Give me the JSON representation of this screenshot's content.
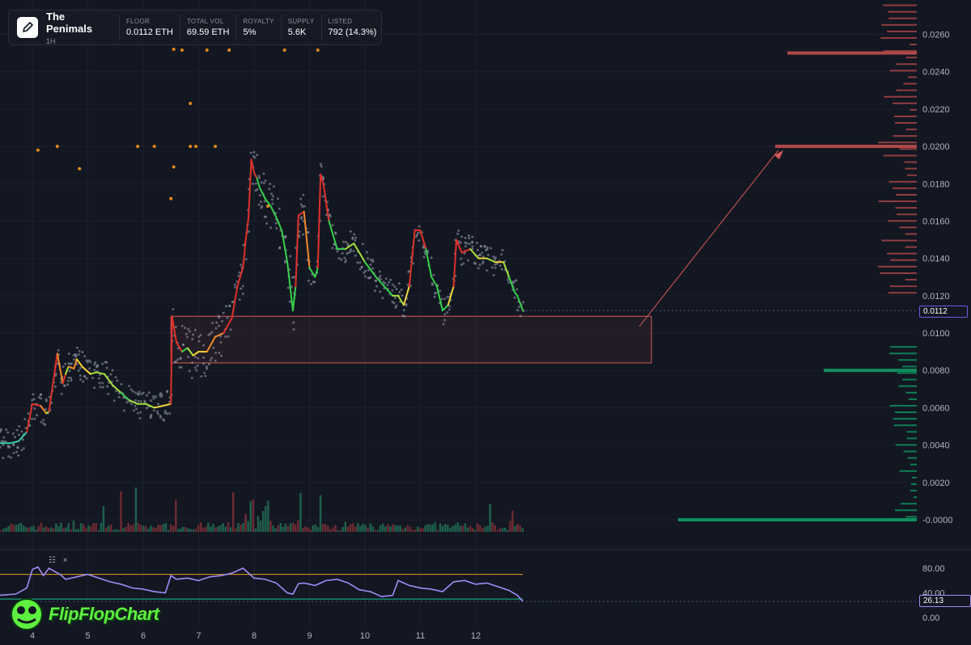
{
  "header": {
    "title": "The Penimals",
    "interval": "1H",
    "stats": [
      {
        "label": "FLOOR",
        "value": "0.0112 ETH"
      },
      {
        "label": "TOTAL VOL",
        "value": "69.59 ETH"
      },
      {
        "label": "ROYALTY",
        "value": "5%"
      },
      {
        "label": "SUPPLY",
        "value": "5.6K"
      },
      {
        "label": "LISTED",
        "value": "792 (14.3%)"
      }
    ]
  },
  "price_tag": "0.0112",
  "rsi_tag": "26.13",
  "watermark": "FlipFlopChart",
  "rsi_tools": {
    "settings": "☷",
    "close": "×"
  },
  "colors": {
    "background": "#131722",
    "ask_wall": "#b04848",
    "bid_wall": "#0f8f5e",
    "rsi_line": "#a08cf8",
    "rsi_upper": "#f0a020",
    "rsi_lower": "#19c39b",
    "zone": "#d65a5a"
  },
  "chart_data": [
    {
      "type": "line",
      "name": "floor price",
      "x_tick_labels": [
        "4",
        "5",
        "6",
        "7",
        "8",
        "9",
        "10",
        "11",
        "12"
      ],
      "y_tick_labels": [
        "0.0260",
        "0.0240",
        "0.0220",
        "0.0200",
        "0.0180",
        "0.0160",
        "0.0140",
        "0.0120",
        "0.0100",
        "0.0080",
        "0.0060",
        "0.0040",
        "0.0020",
        "-0.0000"
      ],
      "ylim": [
        0,
        0.0274
      ],
      "xlim": [
        3.4,
        12.95
      ],
      "x": [
        3.4,
        3.6,
        3.75,
        3.9,
        4.0,
        4.15,
        4.25,
        4.3,
        4.45,
        4.55,
        4.6,
        4.65,
        4.75,
        4.8,
        4.9,
        5.05,
        5.15,
        5.3,
        5.45,
        5.6,
        5.75,
        5.9,
        6.05,
        6.2,
        6.35,
        6.5,
        6.52,
        6.6,
        6.7,
        6.8,
        6.9,
        7.0,
        7.15,
        7.3,
        7.45,
        7.6,
        7.7,
        7.8,
        7.85,
        7.9,
        7.95,
        8.0,
        8.05,
        8.1,
        8.2,
        8.3,
        8.4,
        8.5,
        8.6,
        8.7,
        8.75,
        8.8,
        8.9,
        9.0,
        9.1,
        9.15,
        9.2,
        9.25,
        9.35,
        9.5,
        9.65,
        9.8,
        10.0,
        10.2,
        10.35,
        10.5,
        10.6,
        10.7,
        10.8,
        10.9,
        11.0,
        11.1,
        11.2,
        11.3,
        11.4,
        11.5,
        11.6,
        11.65,
        11.75,
        11.9,
        12.05,
        12.2,
        12.35,
        12.5,
        12.6,
        12.7,
        12.75,
        12.85
      ],
      "y": [
        0.0041,
        0.0041,
        0.0042,
        0.0047,
        0.0062,
        0.0061,
        0.0057,
        0.0058,
        0.0089,
        0.0073,
        0.0078,
        0.0082,
        0.0081,
        0.0086,
        0.0082,
        0.0078,
        0.0079,
        0.0078,
        0.0072,
        0.0068,
        0.0064,
        0.0062,
        0.0062,
        0.006,
        0.0061,
        0.0062,
        0.0109,
        0.0095,
        0.009,
        0.0092,
        0.0088,
        0.009,
        0.009,
        0.0098,
        0.01,
        0.0108,
        0.0125,
        0.0135,
        0.015,
        0.0162,
        0.0193,
        0.0186,
        0.0183,
        0.0178,
        0.0172,
        0.0168,
        0.0162,
        0.0155,
        0.0138,
        0.0112,
        0.0125,
        0.0163,
        0.0165,
        0.0135,
        0.013,
        0.0135,
        0.0185,
        0.018,
        0.016,
        0.0145,
        0.0145,
        0.0148,
        0.0138,
        0.013,
        0.0125,
        0.012,
        0.012,
        0.0115,
        0.0125,
        0.0155,
        0.0155,
        0.0145,
        0.013,
        0.0125,
        0.0112,
        0.0115,
        0.0125,
        0.015,
        0.0143,
        0.0145,
        0.014,
        0.014,
        0.0138,
        0.0138,
        0.013,
        0.0122,
        0.012,
        0.0112
      ]
    },
    {
      "type": "bar",
      "name": "order book walls",
      "price_levels": [
        0.025,
        0.02,
        0.008,
        0.0
      ],
      "sizes": [
        160,
        175,
        115,
        295
      ]
    },
    {
      "type": "line",
      "name": "RSI",
      "y_tick_labels": [
        "80.00",
        "40.00",
        "0.00"
      ],
      "ylim": [
        0,
        100
      ],
      "levels": [
        70,
        30
      ],
      "x": [
        3.4,
        3.7,
        3.9,
        4.0,
        4.1,
        4.2,
        4.3,
        4.5,
        4.6,
        4.8,
        5.0,
        5.2,
        5.4,
        5.6,
        5.8,
        6.0,
        6.2,
        6.4,
        6.5,
        6.6,
        6.8,
        7.0,
        7.2,
        7.4,
        7.6,
        7.8,
        8.0,
        8.2,
        8.4,
        8.6,
        8.7,
        8.8,
        8.9,
        9.1,
        9.3,
        9.5,
        9.7,
        9.9,
        10.1,
        10.3,
        10.5,
        10.6,
        10.8,
        11.0,
        11.2,
        11.4,
        11.6,
        11.8,
        12.0,
        12.2,
        12.4,
        12.6,
        12.75,
        12.85
      ],
      "y": [
        36,
        38,
        48,
        78,
        82,
        68,
        80,
        70,
        62,
        66,
        70,
        64,
        58,
        54,
        48,
        46,
        42,
        40,
        68,
        62,
        64,
        60,
        66,
        68,
        72,
        80,
        64,
        62,
        56,
        40,
        38,
        55,
        56,
        52,
        60,
        62,
        56,
        45,
        42,
        34,
        36,
        60,
        52,
        48,
        46,
        42,
        58,
        60,
        54,
        56,
        50,
        44,
        36,
        26
      ]
    }
  ]
}
